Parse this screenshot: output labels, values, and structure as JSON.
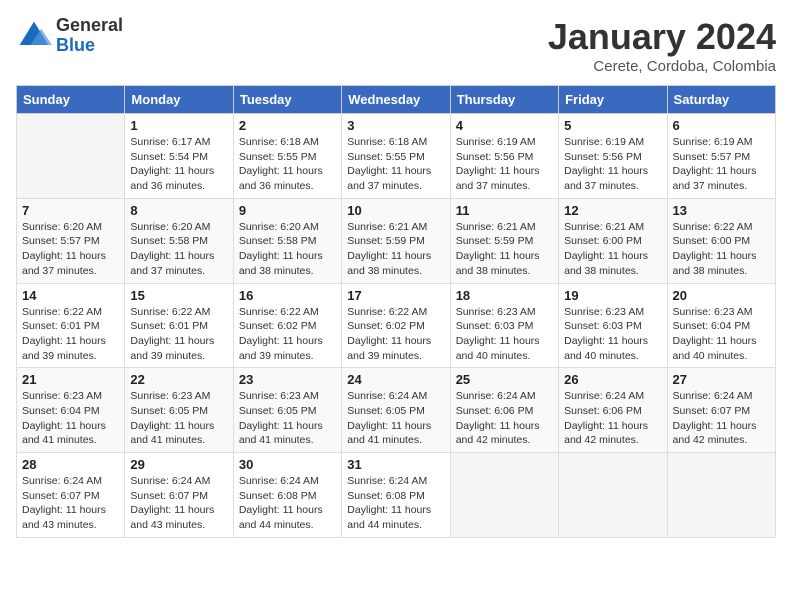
{
  "logo": {
    "general": "General",
    "blue": "Blue"
  },
  "header": {
    "title": "January 2024",
    "location": "Cerete, Cordoba, Colombia"
  },
  "weekdays": [
    "Sunday",
    "Monday",
    "Tuesday",
    "Wednesday",
    "Thursday",
    "Friday",
    "Saturday"
  ],
  "weeks": [
    [
      {
        "day": "",
        "sunrise": "",
        "sunset": "",
        "daylight": ""
      },
      {
        "day": "1",
        "sunrise": "Sunrise: 6:17 AM",
        "sunset": "Sunset: 5:54 PM",
        "daylight": "Daylight: 11 hours and 36 minutes."
      },
      {
        "day": "2",
        "sunrise": "Sunrise: 6:18 AM",
        "sunset": "Sunset: 5:55 PM",
        "daylight": "Daylight: 11 hours and 36 minutes."
      },
      {
        "day": "3",
        "sunrise": "Sunrise: 6:18 AM",
        "sunset": "Sunset: 5:55 PM",
        "daylight": "Daylight: 11 hours and 37 minutes."
      },
      {
        "day": "4",
        "sunrise": "Sunrise: 6:19 AM",
        "sunset": "Sunset: 5:56 PM",
        "daylight": "Daylight: 11 hours and 37 minutes."
      },
      {
        "day": "5",
        "sunrise": "Sunrise: 6:19 AM",
        "sunset": "Sunset: 5:56 PM",
        "daylight": "Daylight: 11 hours and 37 minutes."
      },
      {
        "day": "6",
        "sunrise": "Sunrise: 6:19 AM",
        "sunset": "Sunset: 5:57 PM",
        "daylight": "Daylight: 11 hours and 37 minutes."
      }
    ],
    [
      {
        "day": "7",
        "sunrise": "Sunrise: 6:20 AM",
        "sunset": "Sunset: 5:57 PM",
        "daylight": "Daylight: 11 hours and 37 minutes."
      },
      {
        "day": "8",
        "sunrise": "Sunrise: 6:20 AM",
        "sunset": "Sunset: 5:58 PM",
        "daylight": "Daylight: 11 hours and 37 minutes."
      },
      {
        "day": "9",
        "sunrise": "Sunrise: 6:20 AM",
        "sunset": "Sunset: 5:58 PM",
        "daylight": "Daylight: 11 hours and 38 minutes."
      },
      {
        "day": "10",
        "sunrise": "Sunrise: 6:21 AM",
        "sunset": "Sunset: 5:59 PM",
        "daylight": "Daylight: 11 hours and 38 minutes."
      },
      {
        "day": "11",
        "sunrise": "Sunrise: 6:21 AM",
        "sunset": "Sunset: 5:59 PM",
        "daylight": "Daylight: 11 hours and 38 minutes."
      },
      {
        "day": "12",
        "sunrise": "Sunrise: 6:21 AM",
        "sunset": "Sunset: 6:00 PM",
        "daylight": "Daylight: 11 hours and 38 minutes."
      },
      {
        "day": "13",
        "sunrise": "Sunrise: 6:22 AM",
        "sunset": "Sunset: 6:00 PM",
        "daylight": "Daylight: 11 hours and 38 minutes."
      }
    ],
    [
      {
        "day": "14",
        "sunrise": "Sunrise: 6:22 AM",
        "sunset": "Sunset: 6:01 PM",
        "daylight": "Daylight: 11 hours and 39 minutes."
      },
      {
        "day": "15",
        "sunrise": "Sunrise: 6:22 AM",
        "sunset": "Sunset: 6:01 PM",
        "daylight": "Daylight: 11 hours and 39 minutes."
      },
      {
        "day": "16",
        "sunrise": "Sunrise: 6:22 AM",
        "sunset": "Sunset: 6:02 PM",
        "daylight": "Daylight: 11 hours and 39 minutes."
      },
      {
        "day": "17",
        "sunrise": "Sunrise: 6:22 AM",
        "sunset": "Sunset: 6:02 PM",
        "daylight": "Daylight: 11 hours and 39 minutes."
      },
      {
        "day": "18",
        "sunrise": "Sunrise: 6:23 AM",
        "sunset": "Sunset: 6:03 PM",
        "daylight": "Daylight: 11 hours and 40 minutes."
      },
      {
        "day": "19",
        "sunrise": "Sunrise: 6:23 AM",
        "sunset": "Sunset: 6:03 PM",
        "daylight": "Daylight: 11 hours and 40 minutes."
      },
      {
        "day": "20",
        "sunrise": "Sunrise: 6:23 AM",
        "sunset": "Sunset: 6:04 PM",
        "daylight": "Daylight: 11 hours and 40 minutes."
      }
    ],
    [
      {
        "day": "21",
        "sunrise": "Sunrise: 6:23 AM",
        "sunset": "Sunset: 6:04 PM",
        "daylight": "Daylight: 11 hours and 41 minutes."
      },
      {
        "day": "22",
        "sunrise": "Sunrise: 6:23 AM",
        "sunset": "Sunset: 6:05 PM",
        "daylight": "Daylight: 11 hours and 41 minutes."
      },
      {
        "day": "23",
        "sunrise": "Sunrise: 6:23 AM",
        "sunset": "Sunset: 6:05 PM",
        "daylight": "Daylight: 11 hours and 41 minutes."
      },
      {
        "day": "24",
        "sunrise": "Sunrise: 6:24 AM",
        "sunset": "Sunset: 6:05 PM",
        "daylight": "Daylight: 11 hours and 41 minutes."
      },
      {
        "day": "25",
        "sunrise": "Sunrise: 6:24 AM",
        "sunset": "Sunset: 6:06 PM",
        "daylight": "Daylight: 11 hours and 42 minutes."
      },
      {
        "day": "26",
        "sunrise": "Sunrise: 6:24 AM",
        "sunset": "Sunset: 6:06 PM",
        "daylight": "Daylight: 11 hours and 42 minutes."
      },
      {
        "day": "27",
        "sunrise": "Sunrise: 6:24 AM",
        "sunset": "Sunset: 6:07 PM",
        "daylight": "Daylight: 11 hours and 42 minutes."
      }
    ],
    [
      {
        "day": "28",
        "sunrise": "Sunrise: 6:24 AM",
        "sunset": "Sunset: 6:07 PM",
        "daylight": "Daylight: 11 hours and 43 minutes."
      },
      {
        "day": "29",
        "sunrise": "Sunrise: 6:24 AM",
        "sunset": "Sunset: 6:07 PM",
        "daylight": "Daylight: 11 hours and 43 minutes."
      },
      {
        "day": "30",
        "sunrise": "Sunrise: 6:24 AM",
        "sunset": "Sunset: 6:08 PM",
        "daylight": "Daylight: 11 hours and 44 minutes."
      },
      {
        "day": "31",
        "sunrise": "Sunrise: 6:24 AM",
        "sunset": "Sunset: 6:08 PM",
        "daylight": "Daylight: 11 hours and 44 minutes."
      },
      {
        "day": "",
        "sunrise": "",
        "sunset": "",
        "daylight": ""
      },
      {
        "day": "",
        "sunrise": "",
        "sunset": "",
        "daylight": ""
      },
      {
        "day": "",
        "sunrise": "",
        "sunset": "",
        "daylight": ""
      }
    ]
  ]
}
